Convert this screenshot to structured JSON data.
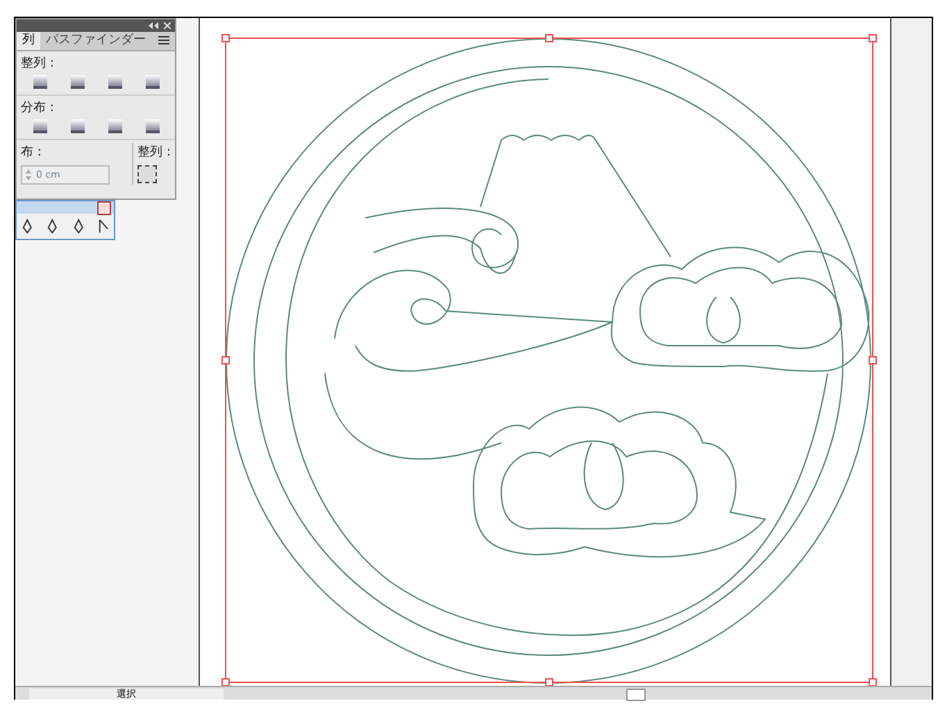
{
  "align_panel": {
    "tabs": [
      {
        "label": "列",
        "selected": true
      },
      {
        "label": "パスファインダー",
        "selected": false
      }
    ],
    "align_objects_label": "整列 :",
    "distribute_objects_label": "分布 :",
    "distribute_spacing_label": "布 :",
    "spacing_value": "0 cm",
    "align_to_label": "整列 :"
  },
  "status_bar": {
    "mode": "選択"
  }
}
